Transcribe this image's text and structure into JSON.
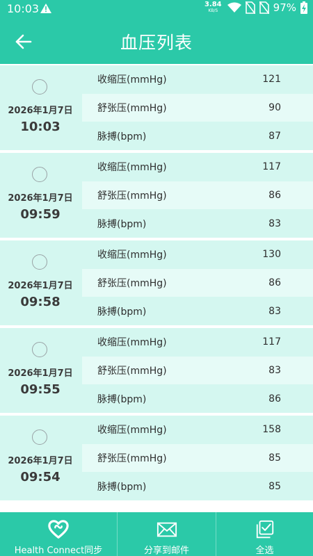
{
  "status_bar": {
    "time": "10:03",
    "net_speed_value": "3.84",
    "net_speed_unit": "KB/S",
    "battery_text": "97%"
  },
  "header": {
    "title": "血压列表"
  },
  "labels": {
    "systolic": "收缩压(mmHg)",
    "diastolic": "舒张压(mmHg)",
    "pulse": "脉搏(bpm)"
  },
  "records": [
    {
      "date": "2026年1月7日",
      "time": "10:03",
      "systolic": "121",
      "diastolic": "90",
      "pulse": "87"
    },
    {
      "date": "2026年1月7日",
      "time": "09:59",
      "systolic": "117",
      "diastolic": "86",
      "pulse": "83"
    },
    {
      "date": "2026年1月7日",
      "time": "09:58",
      "systolic": "130",
      "diastolic": "86",
      "pulse": "83"
    },
    {
      "date": "2026年1月7日",
      "time": "09:55",
      "systolic": "117",
      "diastolic": "83",
      "pulse": "86"
    },
    {
      "date": "2026年1月7日",
      "time": "09:54",
      "systolic": "158",
      "diastolic": "85",
      "pulse": "85"
    }
  ],
  "bottom_bar": {
    "health_connect_label": "Health Connect同步",
    "share_email_label": "分享到邮件",
    "select_all_label": "全选"
  },
  "colors": {
    "accent": "#2bc9a8",
    "row_bg": "#d4f7f0",
    "row_alt_bg": "#e6fbf7"
  }
}
